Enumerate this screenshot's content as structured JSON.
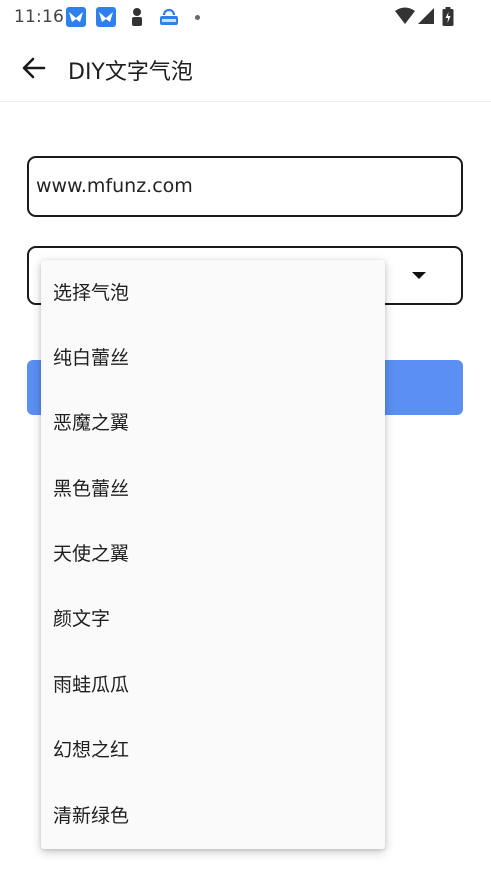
{
  "status_bar": {
    "time": "11:16",
    "icons": [
      "bird-app-icon",
      "bird-app-icon",
      "person-icon",
      "cloud-lock-icon",
      "dot-icon",
      "wifi-icon",
      "signal-icon",
      "battery-icon"
    ]
  },
  "app_bar": {
    "back_icon": "arrow-left-icon",
    "title": "DIY文字气泡"
  },
  "form": {
    "text_value": "www.mfunz.com",
    "select_icon": "dropdown-caret-icon"
  },
  "menu": {
    "items": [
      "选择气泡",
      "纯白蕾丝",
      "恶魔之翼",
      "黑色蕾丝",
      "天使之翼",
      "颜文字",
      "雨蛙瓜瓜",
      "幻想之红",
      "清新绿色"
    ]
  },
  "colors": {
    "button": "#5b8ff2",
    "border": "#1a1a1a",
    "menu_bg": "#fafafa"
  }
}
